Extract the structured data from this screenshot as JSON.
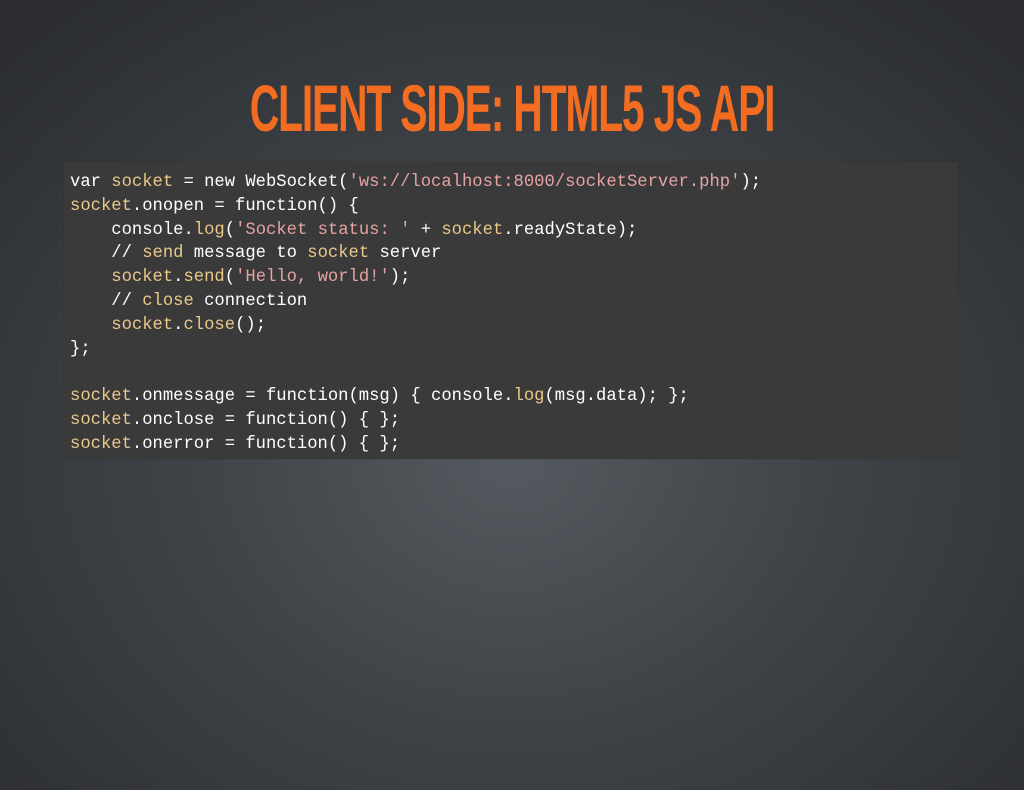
{
  "title": "CLIENT SIDE: HTML5 JS API",
  "colors": {
    "title": "#f26c22",
    "code_background": "#3a3a3a",
    "code_plain": "#ffffff",
    "code_identifier": "#eac88a",
    "code_string": "#e5a3a3"
  },
  "code": {
    "language": "javascript",
    "lines": [
      [
        {
          "t": "var ",
          "k": "plain"
        },
        {
          "t": "socket",
          "k": "ident"
        },
        {
          "t": " = new WebSocket(",
          "k": "plain"
        },
        {
          "t": "'ws://localhost:8000/socketServer.php'",
          "k": "string"
        },
        {
          "t": ");",
          "k": "plain"
        }
      ],
      [
        {
          "t": "socket",
          "k": "ident"
        },
        {
          "t": ".onopen = function() {",
          "k": "plain"
        }
      ],
      [
        {
          "t": "    console.",
          "k": "plain"
        },
        {
          "t": "log",
          "k": "ident"
        },
        {
          "t": "(",
          "k": "plain"
        },
        {
          "t": "'Socket status: '",
          "k": "string"
        },
        {
          "t": " + ",
          "k": "plain"
        },
        {
          "t": "socket",
          "k": "ident"
        },
        {
          "t": ".readyState);",
          "k": "plain"
        }
      ],
      [
        {
          "t": "    // ",
          "k": "plain"
        },
        {
          "t": "send",
          "k": "ident"
        },
        {
          "t": " message to ",
          "k": "plain"
        },
        {
          "t": "socket",
          "k": "ident"
        },
        {
          "t": " server",
          "k": "plain"
        }
      ],
      [
        {
          "t": "    ",
          "k": "plain"
        },
        {
          "t": "socket",
          "k": "ident"
        },
        {
          "t": ".",
          "k": "plain"
        },
        {
          "t": "send",
          "k": "ident"
        },
        {
          "t": "(",
          "k": "plain"
        },
        {
          "t": "'Hello, world!'",
          "k": "string"
        },
        {
          "t": ");",
          "k": "plain"
        }
      ],
      [
        {
          "t": "    // ",
          "k": "plain"
        },
        {
          "t": "close",
          "k": "ident"
        },
        {
          "t": " connection",
          "k": "plain"
        }
      ],
      [
        {
          "t": "    ",
          "k": "plain"
        },
        {
          "t": "socket",
          "k": "ident"
        },
        {
          "t": ".",
          "k": "plain"
        },
        {
          "t": "close",
          "k": "ident"
        },
        {
          "t": "();",
          "k": "plain"
        }
      ],
      [
        {
          "t": "};",
          "k": "plain"
        }
      ],
      [
        {
          "t": "",
          "k": "plain"
        }
      ],
      [
        {
          "t": "socket",
          "k": "ident"
        },
        {
          "t": ".onmessage = function(msg) { console.",
          "k": "plain"
        },
        {
          "t": "log",
          "k": "ident"
        },
        {
          "t": "(msg.data); };",
          "k": "plain"
        }
      ],
      [
        {
          "t": "socket",
          "k": "ident"
        },
        {
          "t": ".onclose = function() { };",
          "k": "plain"
        }
      ],
      [
        {
          "t": "socket",
          "k": "ident"
        },
        {
          "t": ".onerror = function() { };",
          "k": "plain"
        }
      ]
    ]
  }
}
